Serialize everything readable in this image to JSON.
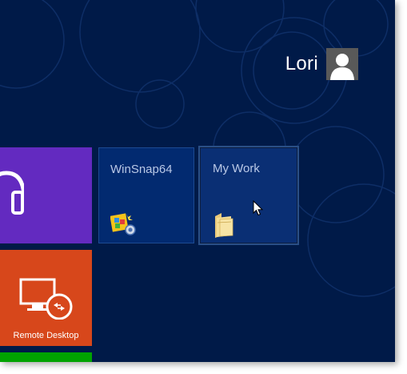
{
  "user": {
    "name": "Lori",
    "avatar_icon": "user-silhouette-icon"
  },
  "tiles": [
    {
      "id": "music",
      "label": "",
      "color": "#632ac0",
      "icon": "headphones-icon"
    },
    {
      "id": "winsnap",
      "label": "WinSnap64",
      "color": "#022a70",
      "icon": "winsnap-app-icon"
    },
    {
      "id": "mywork",
      "label": "My Work",
      "color": "#0a2f74",
      "icon": "folder-icon"
    },
    {
      "id": "remote-desktop",
      "label": "Remote Desktop",
      "color": "#d7471b",
      "icon": "remote-desktop-icon"
    },
    {
      "id": "green",
      "label": "",
      "color": "#00a300",
      "icon": ""
    }
  ],
  "colors": {
    "background": "#001a48",
    "accent_purple": "#632ac0",
    "accent_orange": "#d7471b",
    "accent_green": "#00a300"
  }
}
